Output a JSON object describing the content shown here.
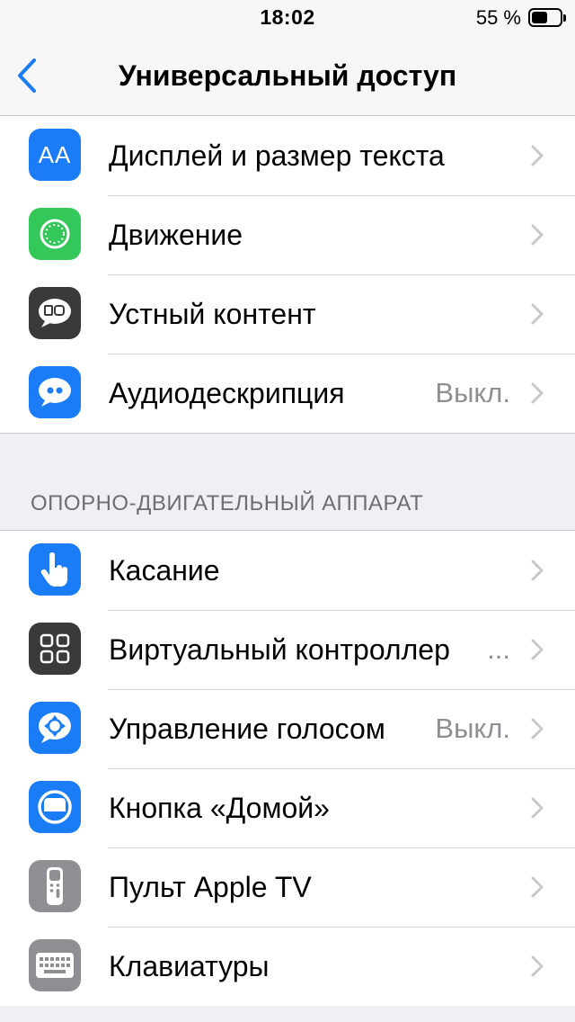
{
  "status_bar": {
    "time": "18:02",
    "battery_text": "55 %",
    "battery_level": 0.55
  },
  "nav": {
    "back_icon": "chevron-left-icon",
    "title": "Универсальный доступ"
  },
  "groups": {
    "vision": {
      "items": [
        {
          "label": "Дисплей и размер текста",
          "value": "",
          "icon": "text-size-icon",
          "icon_color": "#1a7cf6",
          "icon_text": "AA"
        },
        {
          "label": "Движение",
          "value": "",
          "icon": "motion-icon",
          "icon_color": "#34c759"
        },
        {
          "label": "Устный контент",
          "value": "",
          "icon": "spoken-content-icon",
          "icon_color": "#3a3a3c"
        },
        {
          "label": "Аудиодескрипция",
          "value": "Выкл.",
          "icon": "audio-description-icon",
          "icon_color": "#1a7cf6"
        }
      ]
    },
    "motor": {
      "header": "ОПОРНО-ДВИГАТЕЛЬНЫЙ АППАРАТ",
      "items": [
        {
          "label": "Касание",
          "value": "",
          "icon": "touch-icon",
          "icon_color": "#1a7cf6"
        },
        {
          "label": "Виртуальный контроллер",
          "value": "...",
          "icon": "switch-control-icon",
          "icon_color": "#3a3a3c"
        },
        {
          "label": "Управление голосом",
          "value": "Выкл.",
          "icon": "voice-control-icon",
          "icon_color": "#1a7cf6"
        },
        {
          "label": "Кнопка «Домой»",
          "value": "",
          "icon": "home-button-icon",
          "icon_color": "#1a7cf6"
        },
        {
          "label": "Пульт Apple TV",
          "value": "",
          "icon": "apple-tv-remote-icon",
          "icon_color": "#8e8e93"
        },
        {
          "label": "Клавиатуры",
          "value": "",
          "icon": "keyboard-icon",
          "icon_color": "#8e8e93"
        }
      ]
    }
  },
  "colors": {
    "accent": "#1a7cf6",
    "background": "#efeff4",
    "secondary_text": "#8e8e93"
  }
}
